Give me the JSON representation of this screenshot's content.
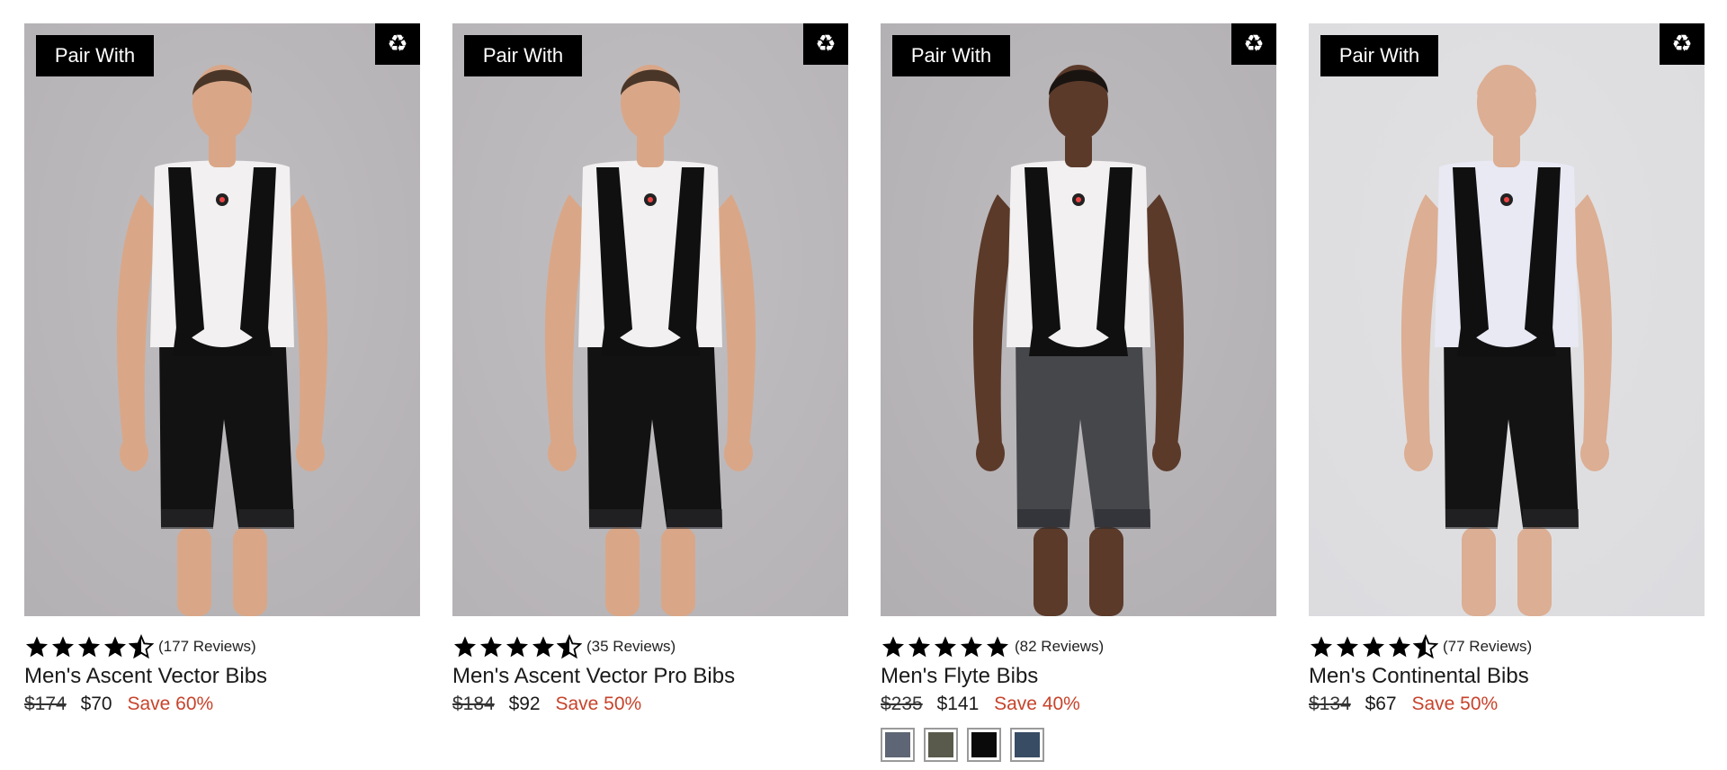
{
  "products": [
    {
      "badge": "Pair With",
      "icon": "recycle-icon",
      "rating": 4.5,
      "reviews": "177 Reviews",
      "title": "Men's Ascent Vector Bibs",
      "price_old": "$174",
      "price_new": "$70",
      "save": "Save 60%",
      "bg": "#b4b1b4",
      "skin": "#d9a788",
      "hair": "#4a3628",
      "shorts": "#121212",
      "jersey": "#f2f0f0"
    },
    {
      "badge": "Pair With",
      "icon": "recycle-icon",
      "rating": 4.5,
      "reviews": "35 Reviews",
      "title": "Men's Ascent Vector Pro Bibs",
      "price_old": "$184",
      "price_new": "$92",
      "save": "Save 50%",
      "bg": "#b6b3b6",
      "skin": "#d9a788",
      "hair": "#4a3628",
      "shorts": "#121212",
      "jersey": "#f2f0f0"
    },
    {
      "badge": "Pair With",
      "icon": "recycle-icon",
      "rating": 5,
      "reviews": "82 Reviews",
      "title": "Men's Flyte Bibs",
      "price_old": "$235",
      "price_new": "$141",
      "save": "Save 40%",
      "bg": "#b2afb2",
      "skin": "#5b3a2a",
      "hair": "#1a1411",
      "shorts": "#45474b",
      "jersey": "#f2f0f0",
      "swatches": [
        "#5e6574",
        "#5a5a4c",
        "#0a0a0a",
        "#384c64"
      ]
    },
    {
      "badge": "Pair With",
      "icon": "recycle-icon",
      "rating": 4.5,
      "reviews": "77 Reviews",
      "title": "Men's Continental Bibs",
      "price_old": "$134",
      "price_new": "$67",
      "save": "Save 50%",
      "bg": "#dcdcdf",
      "skin": "#dcae93",
      "hair": "#dcae93",
      "shorts": "#131313",
      "jersey": "#e8e9f3"
    }
  ],
  "colors": {
    "save": "#c8432b",
    "badge_bg": "#000000",
    "star": "#000000"
  }
}
